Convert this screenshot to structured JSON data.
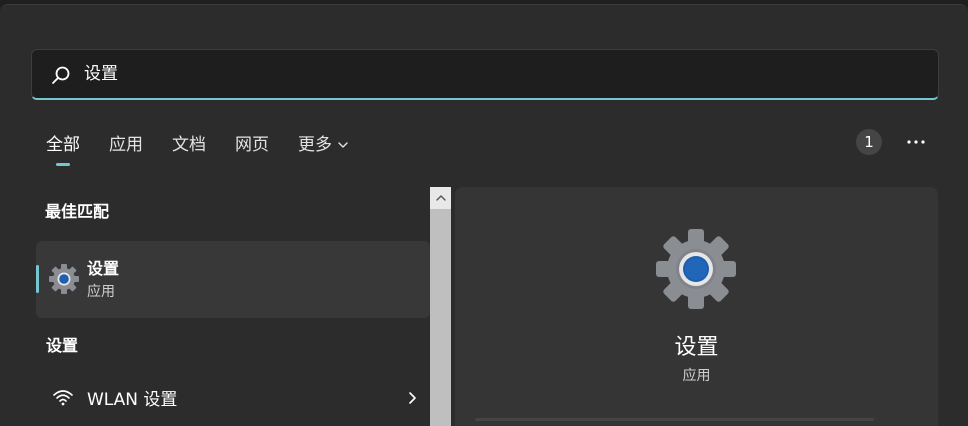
{
  "search": {
    "query": "设置"
  },
  "tabs": [
    {
      "label": "全部",
      "active": true
    },
    {
      "label": "应用",
      "active": false
    },
    {
      "label": "文档",
      "active": false
    },
    {
      "label": "网页",
      "active": false
    },
    {
      "label": "更多",
      "active": false
    }
  ],
  "badge": "1",
  "best_match": {
    "section_title": "最佳匹配",
    "name": "设置",
    "type": "应用"
  },
  "settings_section": {
    "title": "设置",
    "items": [
      {
        "label": "WLAN 设置"
      }
    ]
  },
  "preview": {
    "name": "设置",
    "type": "应用"
  },
  "colors": {
    "accent": "#76c6d0",
    "panel": "#2c2c2c",
    "preview_bg": "#353535",
    "selected_bg": "#383838"
  },
  "icons": {
    "search": "search-icon",
    "more": "more-icon",
    "gear": "settings-gear-icon",
    "wifi": "wifi-icon",
    "chevron": "chevron-right-icon"
  }
}
